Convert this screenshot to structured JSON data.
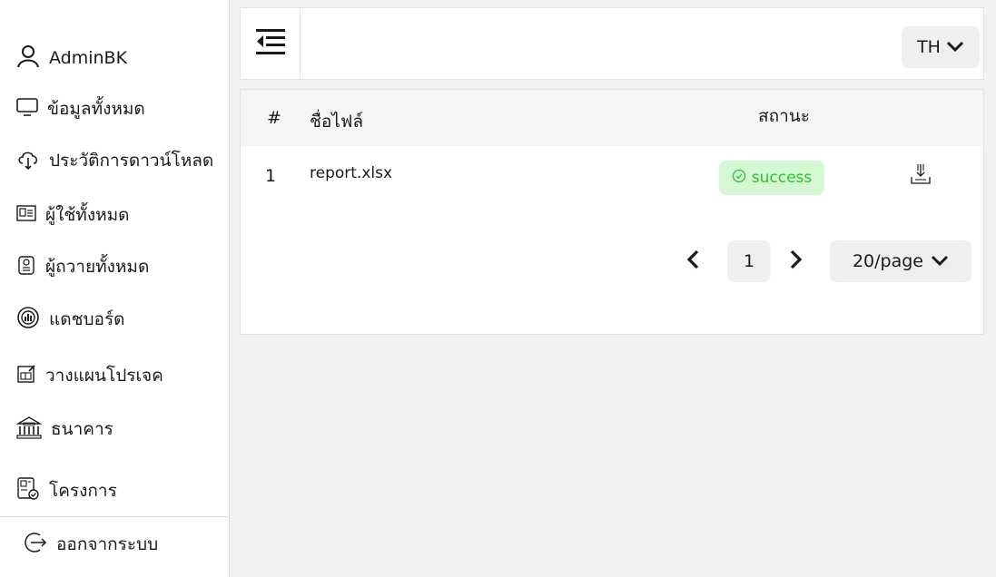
{
  "sidebar": {
    "user": {
      "name": "AdminBK",
      "icon": "user-icon"
    },
    "items": [
      {
        "label": "ข้อมูลทั้งหมด",
        "icon": "monitor-icon"
      },
      {
        "label": "ประวัติการดาวน์โหลด",
        "icon": "cloud-download-icon"
      },
      {
        "label": "ผู้ใช้ทั้งหมด",
        "icon": "id-card-icon"
      },
      {
        "label": "ผู้ถวายทั้งหมด",
        "icon": "donor-icon"
      },
      {
        "label": "แดชบอร์ด",
        "icon": "dashboard-icon"
      },
      {
        "label": "วางแผนโปรเจค",
        "icon": "project-plan-icon"
      },
      {
        "label": "ธนาคาร",
        "icon": "bank-icon"
      },
      {
        "label": "โครงการ",
        "icon": "project-icon"
      }
    ],
    "logout_label": "ออกจากระบบ"
  },
  "topbar": {
    "language": "TH",
    "menu_icon": "collapse-menu-icon"
  },
  "table": {
    "columns": [
      "#",
      "ชื่อไฟล์",
      "สถานะ"
    ],
    "rows": [
      {
        "index": "1",
        "file_name": "report.xlsx",
        "status": "success"
      }
    ],
    "status_color": "#2dbf2d",
    "status_bg": "#d4f7d4"
  },
  "pagination": {
    "current_page": "1",
    "page_size": "20/page"
  }
}
